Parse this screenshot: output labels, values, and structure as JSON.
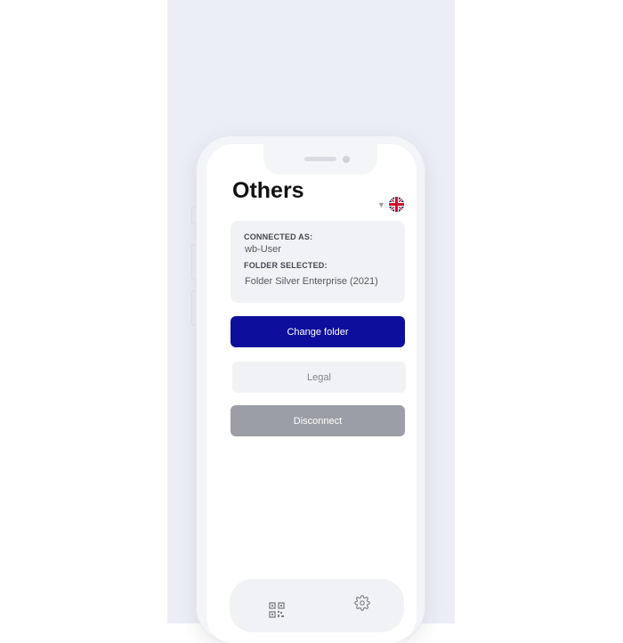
{
  "screen": {
    "title": "Others"
  },
  "language": {
    "selected_flag": "uk-flag-icon",
    "dropdown_icon": "caret-down-icon"
  },
  "info_card": {
    "connected_label": "CONNECTED AS:",
    "connected_value": "wb-User",
    "folder_label": "FOLDER SELECTED:",
    "folder_value": "Folder Silver Enterprise (2021)"
  },
  "actions": {
    "change_folder": "Change folder",
    "legal": "Legal",
    "disconnect": "Disconnect"
  },
  "bottom_nav": {
    "items": [
      "qr-code-icon",
      "gear-icon"
    ]
  },
  "colors": {
    "primary": "#0d0e9c",
    "disconnect": "#9c9ea5",
    "card": "#f1f2f5"
  }
}
